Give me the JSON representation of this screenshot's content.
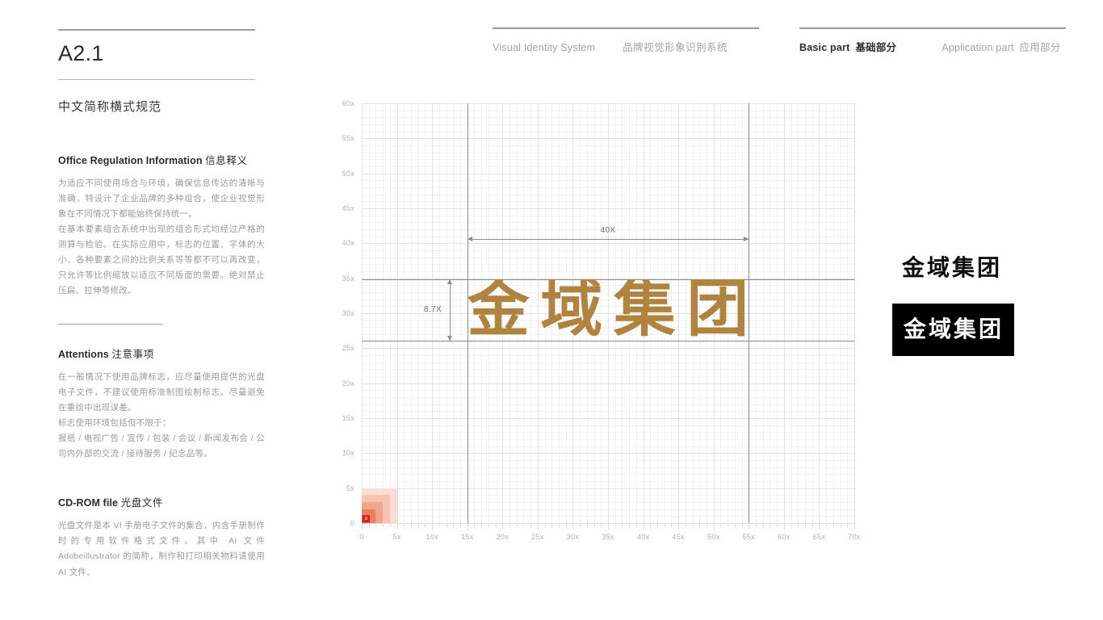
{
  "header": {
    "left_group": [
      {
        "en": "Visual Identity System",
        "cn": "",
        "active": false
      },
      {
        "en": "",
        "cn": "品牌视觉形象识别系统",
        "active": false
      }
    ],
    "right_group": [
      {
        "en": "Basic part",
        "cn": "基础部分",
        "active": true
      },
      {
        "en": "Application part",
        "cn": "应用部分",
        "active": false
      }
    ]
  },
  "left": {
    "page_number": "A2.1",
    "section_subtitle": "中文简称横式规范",
    "blocks": [
      {
        "heading_en": "Office Regulation Information",
        "heading_cn": "信息释义",
        "paragraphs": [
          "为适应不同使用场合与环境，确保信息传达的清晰与准确，特设计了企业品牌的多种组合，使企业视觉形象在不同情况下都能始终保持统一。",
          "在基本要素组合系统中出现的组合形式均经过严格的测算与检验。在实际应用中，标志的位置、字体的大小、各种要素之间的比例关系等等都不可以再改变，只允许等比例缩放以适应不同版面的需要。绝对禁止压扁、拉伸等修改。"
        ]
      },
      {
        "heading_en": "Attentions",
        "heading_cn": "注意事项",
        "paragraphs": [
          "在一般情况下使用品牌标志，应尽量使用提供的光盘电子文件，不建议使用标准制图绘制标志。尽量避免在重绘中出现误差。",
          "标志使用环境包括但不限于：",
          "报纸 / 电视广告 / 宣传 / 包装 / 会议 / 新闻发布会 / 公司内外部的交流 / 接待服务 / 纪念品等。"
        ]
      },
      {
        "heading_en": "CD-ROM file",
        "heading_cn": "光盘文件",
        "paragraphs": [
          "光盘文件是本 VI 手册电子文件的集合，内含手册制作时的专用软件格式文件。其中 AI 文件 Adobeillustrator 的简称，制作和打印相关物料请使用 AI 文件。"
        ]
      }
    ]
  },
  "logo": {
    "text": "金域集团",
    "grid_color": "#b0833f",
    "light_variant_color": "#0d0d0d",
    "dark_variant_bg": "#000000",
    "dark_variant_color": "#ffffff"
  },
  "chart_data": {
    "type": "diagram-grid",
    "title": "",
    "xlabel": "",
    "ylabel": "",
    "xlim": [
      0,
      70
    ],
    "ylim": [
      0,
      60
    ],
    "x_ticks": [
      "0",
      "5x",
      "10x",
      "15x",
      "20x",
      "25x",
      "30x",
      "35x",
      "40x",
      "45x",
      "50x",
      "55x",
      "60x",
      "65x",
      "70x"
    ],
    "y_ticks": [
      "0",
      "5x",
      "10x",
      "15x",
      "20x",
      "25x",
      "30x",
      "35x",
      "40x",
      "45x",
      "50x",
      "55x",
      "60x"
    ],
    "x_tick_values": [
      0,
      5,
      10,
      15,
      20,
      25,
      30,
      35,
      40,
      45,
      50,
      55,
      60,
      65,
      70
    ],
    "y_tick_values": [
      0,
      5,
      10,
      15,
      20,
      25,
      30,
      35,
      40,
      45,
      50,
      55,
      60
    ],
    "minor_step": 1,
    "major_step": 5,
    "grid": true,
    "guides_vertical": [
      15,
      55
    ],
    "guides_horizontal": [
      26.1,
      34.8
    ],
    "annotations": [
      {
        "label": "40X",
        "orientation": "horizontal",
        "from": 15,
        "to": 55,
        "at": 40.6
      },
      {
        "label": "8.7X",
        "orientation": "vertical",
        "from": 26.1,
        "to": 34.8,
        "at": 12.5
      }
    ],
    "logo_box": {
      "x0": 15,
      "x1": 55,
      "y0": 26.1,
      "y1": 34.8
    },
    "unit_swatch": {
      "label": "x",
      "origin": [
        0,
        0
      ],
      "size": 5,
      "steps": [
        {
          "size": 5,
          "color": "#f8ddd4"
        },
        {
          "size": 4,
          "color": "#f5c4b3"
        },
        {
          "size": 3,
          "color": "#f0a58c"
        },
        {
          "size": 2,
          "color": "#ea7f5f"
        },
        {
          "size": 1,
          "color": "#e8603c"
        }
      ],
      "chip_color": "#d91f1f"
    }
  }
}
